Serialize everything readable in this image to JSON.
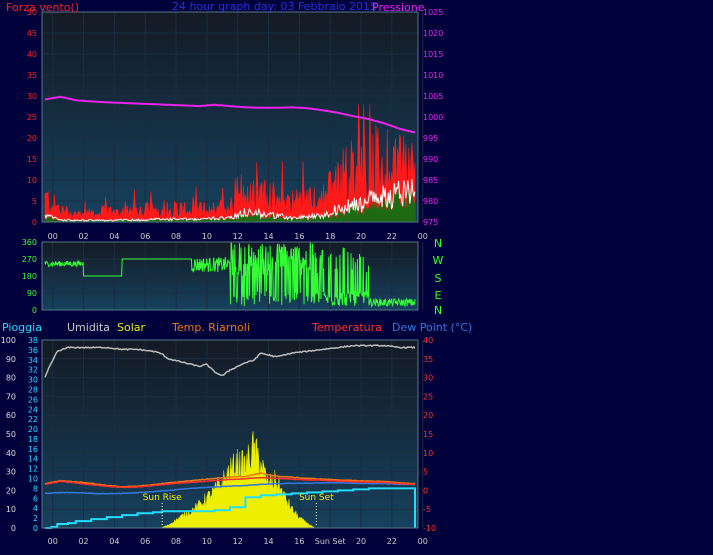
{
  "chart_data": [
    {
      "type": "line",
      "panel": "wind-pressure",
      "title": "24 hour graph day: 03 Febbraio 2015",
      "left_label": "Forza vento()",
      "right_label": "Pressione",
      "x_ticks": [
        "00",
        "02",
        "04",
        "06",
        "08",
        "10",
        "12",
        "14",
        "16",
        "18",
        "20",
        "22",
        "00"
      ],
      "y_left": {
        "min": 0,
        "max": 50,
        "ticks": [
          "0",
          "5",
          "10",
          "15",
          "20",
          "25",
          "30",
          "35",
          "40",
          "45",
          "50"
        ]
      },
      "y_right": {
        "min": 975,
        "max": 1025,
        "ticks": [
          "975",
          "980",
          "985",
          "990",
          "995",
          "1000",
          "1005",
          "1010",
          "1015",
          "1020",
          "1025"
        ]
      },
      "series": [
        {
          "key": "pressure",
          "axis": "right",
          "x": [
            0,
            1,
            2,
            3,
            4,
            6,
            8,
            10,
            11,
            12,
            13,
            14,
            15,
            16,
            17,
            18,
            19,
            20,
            21,
            22,
            23,
            24
          ],
          "values": [
            1004.2,
            1004.8,
            1004.0,
            1003.7,
            1003.5,
            1003.2,
            1002.9,
            1002.6,
            1002.9,
            1002.6,
            1002.3,
            1002.2,
            1002.2,
            1002.3,
            1002.1,
            1001.6,
            1001.0,
            1000.2,
            999.5,
            998.5,
            997.2,
            996.3
          ]
        },
        {
          "key": "gust",
          "axis": "left",
          "x": [
            0,
            1,
            2,
            4,
            6,
            8,
            10,
            12,
            14,
            16,
            18,
            19,
            20,
            21,
            22,
            23,
            24
          ],
          "values": [
            6,
            3,
            2,
            2.5,
            3,
            3.5,
            3,
            4,
            7,
            5,
            6,
            11,
            13,
            14,
            15,
            16,
            12
          ]
        },
        {
          "key": "wind_avg",
          "axis": "left",
          "x": [
            0,
            1,
            2,
            4,
            6,
            8,
            10,
            12,
            13,
            14,
            15,
            16,
            17,
            18,
            19,
            20,
            21,
            22,
            23,
            24
          ],
          "values": [
            1.5,
            0.5,
            0.4,
            0.4,
            0.5,
            0.7,
            0.6,
            1.2,
            2.5,
            2.0,
            1.5,
            1.0,
            1.2,
            1.5,
            3,
            4,
            5,
            6,
            7,
            8
          ]
        }
      ]
    },
    {
      "type": "scatter",
      "panel": "wind-direction",
      "y_left": {
        "min": 0,
        "max": 360,
        "ticks": [
          "0",
          "90",
          "180",
          "270",
          "360"
        ]
      },
      "compass": [
        "N",
        "W",
        "S",
        "E",
        "N"
      ]
    },
    {
      "type": "line",
      "panel": "weather",
      "legend": {
        "rain": "Pioggia",
        "humidity": "Umidita",
        "solar": "Solar",
        "heat_index": "Temp. Riarnoli",
        "temperature": "Temperatura",
        "dew_point": "Dew Point (°C)"
      },
      "x_ticks": [
        "00",
        "02",
        "04",
        "06",
        "08",
        "10",
        "12",
        "14",
        "16",
        "Sun Set",
        "20",
        "22",
        "00"
      ],
      "y_humidity": {
        "min": 0,
        "max": 100,
        "ticks": [
          "0",
          "10",
          "20",
          "30",
          "40",
          "50",
          "60",
          "70",
          "80",
          "90",
          "100"
        ]
      },
      "y_rain": {
        "min": 0,
        "max": 38,
        "ticks": [
          "0",
          "2",
          "4",
          "6",
          "8",
          "10",
          "12",
          "14",
          "16",
          "18",
          "20",
          "22",
          "24",
          "26",
          "28",
          "30",
          "32",
          "34",
          "36",
          "38"
        ]
      },
      "y_temp": {
        "min": -10,
        "max": 40,
        "ticks": [
          "-10",
          "-5",
          "0",
          "5",
          "10",
          "15",
          "20",
          "25",
          "30",
          "35",
          "40"
        ]
      },
      "annotations": [
        {
          "label": "Sun Rise",
          "hour": 7.6
        },
        {
          "label": "Sun Set",
          "hour": 17.6
        }
      ],
      "series": [
        {
          "key": "humidity",
          "axis": "humidity",
          "x": [
            0,
            0.3,
            0.8,
            1.5,
            3,
            4,
            5,
            6,
            7,
            7.5,
            8,
            9,
            10,
            10.5,
            11,
            11.5,
            12,
            12.5,
            13,
            13.5,
            14,
            15,
            16,
            17,
            18,
            19,
            20,
            21,
            22,
            23,
            24
          ],
          "values": [
            80,
            86,
            94,
            96,
            96,
            96,
            95,
            95,
            94,
            93,
            90,
            88,
            86,
            87,
            83,
            81,
            84,
            86,
            88,
            89,
            93,
            91,
            93,
            94,
            95,
            96,
            97,
            97,
            97,
            96,
            96
          ]
        },
        {
          "key": "heat_index",
          "axis": "temp",
          "x": [
            0,
            1,
            2,
            3,
            4,
            5,
            6,
            7,
            8,
            9,
            10,
            11,
            12,
            13,
            14,
            15,
            16,
            17,
            18,
            19,
            20,
            21,
            22,
            23,
            24
          ],
          "values": [
            1.8,
            2.6,
            2.3,
            1.9,
            1.3,
            1.0,
            1.1,
            1.5,
            2.0,
            2.4,
            2.8,
            3.2,
            3.6,
            3.7,
            4.6,
            3.8,
            3.5,
            3.2,
            3.0,
            2.8,
            2.6,
            2.5,
            2.4,
            2.0,
            1.8
          ]
        },
        {
          "key": "temperature",
          "axis": "temp",
          "x": [
            0,
            1,
            2,
            3,
            4,
            5,
            6,
            7,
            8,
            9,
            10,
            11,
            12,
            13,
            14,
            15,
            16,
            17,
            18,
            19,
            20,
            21,
            22,
            23,
            24
          ],
          "values": [
            1.6,
            2.4,
            2.0,
            1.5,
            1.1,
            0.8,
            0.9,
            1.3,
            1.7,
            2.0,
            2.3,
            2.6,
            2.9,
            3.1,
            3.4,
            3.2,
            3.0,
            2.8,
            2.7,
            2.5,
            2.3,
            2.2,
            2.1,
            1.8,
            1.6
          ]
        },
        {
          "key": "dew_point",
          "axis": "temp",
          "x": [
            0,
            1,
            2,
            3,
            4,
            5,
            6,
            7,
            8,
            9,
            10,
            11,
            12,
            13,
            14,
            15,
            16,
            17,
            18,
            19,
            20,
            21,
            22,
            23,
            24
          ],
          "values": [
            -0.8,
            -0.6,
            -0.6,
            -0.8,
            -0.9,
            -0.8,
            -0.6,
            -0.3,
            0.0,
            0.4,
            0.7,
            0.9,
            1.1,
            1.3,
            1.6,
            1.8,
            1.9,
            1.9,
            2.0,
            2.0,
            1.9,
            1.8,
            1.8,
            1.6,
            1.6
          ]
        },
        {
          "key": "rain",
          "axis": "rain",
          "x": [
            0,
            0.4,
            0.8,
            1.5,
            2,
            3,
            4,
            5,
            6,
            7,
            7.6,
            8,
            9,
            10,
            11,
            12,
            13,
            14,
            15,
            16,
            17,
            18,
            19,
            20,
            21,
            22,
            23,
            23.8,
            24
          ],
          "values": [
            0,
            0.2,
            0.8,
            1.0,
            1.4,
            1.8,
            2.2,
            2.6,
            3.0,
            3.2,
            3.4,
            3.4,
            3.4,
            3.4,
            3.6,
            4.2,
            6.2,
            6.6,
            6.8,
            7.0,
            7.2,
            7.4,
            7.6,
            7.8,
            8.0,
            8.0,
            8.0,
            8.0,
            0
          ]
        },
        {
          "key": "solar",
          "axis": "rain",
          "x": [
            7.5,
            8,
            9,
            9.5,
            10,
            10.5,
            11,
            11.5,
            12,
            12.5,
            13,
            13.5,
            14,
            14.5,
            15,
            15.5,
            16,
            16.5,
            17,
            17.5
          ],
          "values": [
            0,
            0.6,
            2.6,
            3.4,
            4.6,
            6.0,
            7.4,
            9.2,
            11.4,
            13.0,
            12.4,
            16.0,
            13.0,
            8.6,
            9.6,
            6.4,
            3.8,
            2.0,
            1.0,
            0
          ]
        }
      ]
    }
  ],
  "colors": {
    "plot_bg": "#141a2a",
    "grid": "#1a2e40",
    "gust": "#ff1a1a",
    "wind_avg": "#ffffff",
    "wind_low": "#1d6a12",
    "pressure": "#ee22ee",
    "direction": "#33ff33",
    "humidity": "#bbbbbb",
    "heat_index": "#ee7711",
    "temperature": "#ff3030",
    "dew_point": "#3377dd",
    "rain": "#22ddff",
    "solar": "#eeee00"
  }
}
